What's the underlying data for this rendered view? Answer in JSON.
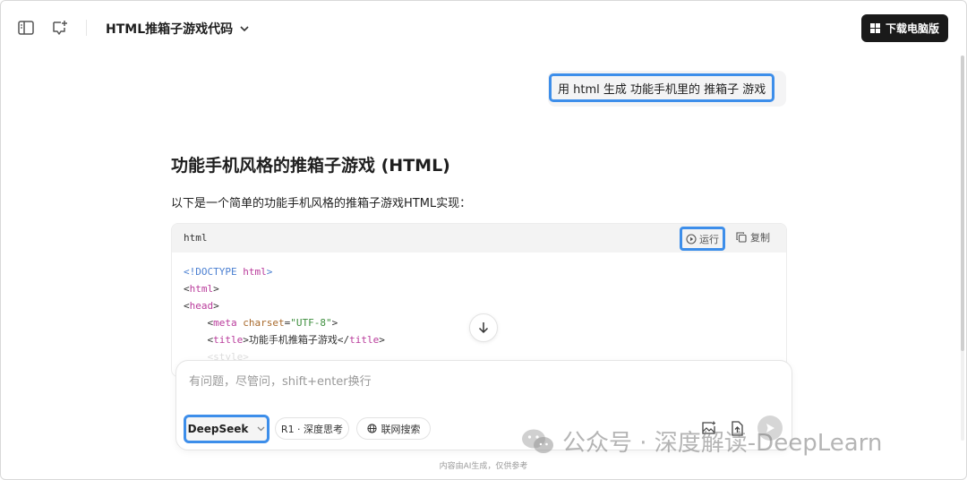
{
  "header": {
    "conversation_title": "HTML推箱子游戏代码",
    "download_label": "下载电脑版"
  },
  "user_message": "用 html 生成 功能手机里的 推箱子 游戏",
  "answer": {
    "title": "功能手机风格的推箱子游戏 (HTML)",
    "intro": "以下是一个简单的功能手机风格的推箱子游戏HTML实现：",
    "code": {
      "language": "html",
      "run_label": "运行",
      "copy_label": "复制",
      "lines": {
        "l1_doc": "<!DOCTYPE",
        "l1_html": "html",
        "l1_close": ">",
        "l2_open": "<",
        "l2_tag": "html",
        "l2_close": ">",
        "l3_open": "<",
        "l3_tag": "head",
        "l3_close": ">",
        "l4_open": "<",
        "l4_tag": "meta",
        "l4_attr": "charset",
        "l4_eq": "=",
        "l4_val": "\"UTF-8\"",
        "l4_close": ">",
        "l5_open": "<",
        "l5_tag": "title",
        "l5_mid": ">",
        "l5_text": "功能手机推箱子游戏",
        "l5_end_open": "</",
        "l5_end_tag": "title",
        "l5_end_close": ">",
        "l6_faded": "<style>"
      }
    }
  },
  "composer": {
    "placeholder": "有问题，尽管问，shift+enter换行",
    "model_label": "DeepSeek",
    "deep_think_label": "R1 · 深度思考",
    "web_search_label": "联网搜索"
  },
  "footer_note": "内容由AI生成，仅供参考",
  "watermark": "公众号 · 深度解读-DeepLearn",
  "colors": {
    "highlight_border": "#3d8eea",
    "download_bg": "#1a1a1a"
  }
}
